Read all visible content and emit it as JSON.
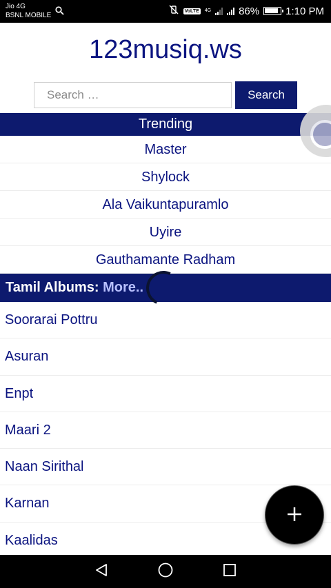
{
  "status_bar": {
    "carrier_1": "Jio 4G",
    "carrier_2": "BSNL MOBILE",
    "volte": "VoLTE",
    "network": "4G",
    "battery_percent": "86%",
    "time": "1:10 PM"
  },
  "site": {
    "title": "123musiq.ws"
  },
  "search": {
    "placeholder": "Search …",
    "button_label": "Search"
  },
  "trending": {
    "header": "Trending",
    "items": [
      "Master",
      "Shylock",
      "Ala Vaikuntapuramlo",
      "Uyire",
      "Gauthamante Radham"
    ]
  },
  "albums": {
    "label": "Tamil Albums:",
    "more_link": "More..",
    "items": [
      "Soorarai Pottru",
      "Asuran",
      "Enpt",
      "Maari 2",
      "Naan Sirithal",
      "Karnan",
      "Kaalidas"
    ]
  },
  "colors": {
    "brand": "#0d1a6e",
    "link": "#0b1480",
    "status_bar": "#000000"
  },
  "icons": {
    "status_search": "search-icon",
    "mute": "mute-vibrate-icon",
    "signal": "signal-icon",
    "battery": "battery-icon",
    "fab": "plus-icon",
    "nav": [
      "back-icon",
      "home-icon",
      "recents-icon"
    ]
  }
}
